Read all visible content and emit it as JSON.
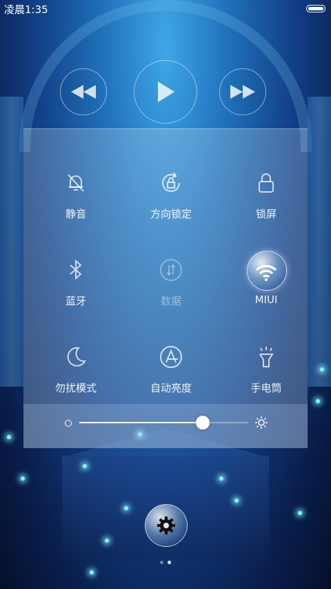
{
  "status_bar": {
    "time": "凌晨1:35"
  },
  "media": {
    "prev_icon": "rewind-icon",
    "play_icon": "play-icon",
    "next_icon": "fast-forward-icon"
  },
  "toggles": [
    {
      "label": "静音",
      "icon": "bell-off-icon",
      "active": false
    },
    {
      "label": "方向锁定",
      "icon": "rotation-lock-icon",
      "active": false
    },
    {
      "label": "锁屏",
      "icon": "lock-icon",
      "active": false
    },
    {
      "label": "蓝牙",
      "icon": "bluetooth-icon",
      "active": false
    },
    {
      "label": "数据",
      "icon": "mobile-data-icon",
      "active": false,
      "disabled": true
    },
    {
      "label": "MIUI",
      "icon": "wifi-icon",
      "active": true
    },
    {
      "label": "勿扰模式",
      "icon": "moon-icon",
      "active": false
    },
    {
      "label": "自动亮度",
      "icon": "auto-brightness-icon",
      "active": false
    },
    {
      "label": "手电筒",
      "icon": "flashlight-icon",
      "active": false
    }
  ],
  "brightness": {
    "level": 0.73,
    "low_icon": "brightness-low-icon",
    "high_icon": "brightness-high-icon"
  },
  "settings": {
    "icon": "gear-icon"
  },
  "pager": {
    "count": 2,
    "current": 2
  }
}
